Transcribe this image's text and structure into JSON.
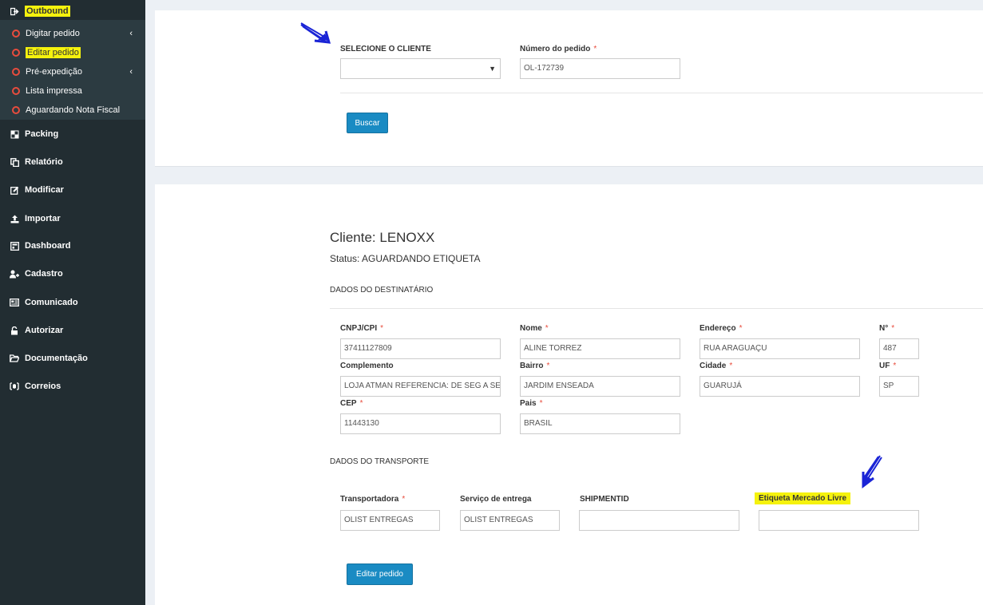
{
  "sidebar": {
    "outbound": {
      "label": "Outbound",
      "icon": "sign-out-icon"
    },
    "submenu": [
      {
        "label": "Digitar pedido",
        "has_chevron": true
      },
      {
        "label": "Editar pedido",
        "highlighted": true
      },
      {
        "label": "Pré-expedição",
        "has_chevron": true
      },
      {
        "label": "Lista impressa"
      },
      {
        "label": "Aguardando Nota Fiscal"
      }
    ],
    "items": [
      {
        "label": "Packing",
        "icon": "packing-icon"
      },
      {
        "label": "Relatório",
        "icon": "copy-icon"
      },
      {
        "label": "Modificar",
        "icon": "edit-icon"
      },
      {
        "label": "Importar",
        "icon": "upload-icon"
      },
      {
        "label": "Dashboard",
        "icon": "dashboard-icon"
      },
      {
        "label": "Cadastro",
        "icon": "user-add-icon"
      },
      {
        "label": "Comunicado",
        "icon": "newspaper-icon"
      },
      {
        "label": "Autorizar",
        "icon": "unlock-icon"
      },
      {
        "label": "Documentação",
        "icon": "folder-open-icon"
      },
      {
        "label": "Correios",
        "icon": "box-icon"
      }
    ]
  },
  "search": {
    "client_label": "SELECIONE O CLIENTE",
    "client_value": "",
    "order_label": "Número do pedido",
    "order_value": "OL-172739",
    "search_button": "Buscar"
  },
  "order": {
    "client_title": "Cliente: LENOXX",
    "status": "Status: AGUARDANDO ETIQUETA",
    "recipient_section": "DADOS DO DESTINATÁRIO",
    "transport_section": "DADOS DO TRANSPORTE",
    "required_mark": "*",
    "fields": {
      "cnpj": {
        "label": "CNPJ/CPI",
        "value": "37411127809"
      },
      "nome": {
        "label": "Nome",
        "value": "ALINE TORREZ"
      },
      "endereco": {
        "label": "Endereço",
        "value": "RUA ARAGUAÇU"
      },
      "numero": {
        "label": "N°",
        "value": "487"
      },
      "complemento": {
        "label": "Complemento",
        "value": "LOJA ATMAN REFERENCIA: DE SEG A SEX"
      },
      "bairro": {
        "label": "Bairro",
        "value": "JARDIM ENSEADA"
      },
      "cidade": {
        "label": "Cidade",
        "value": "GUARUJÁ"
      },
      "uf": {
        "label": "UF",
        "value": "SP"
      },
      "cep": {
        "label": "CEP",
        "value": "11443130"
      },
      "pais": {
        "label": "Pais",
        "value": "BRASIL"
      },
      "transportadora": {
        "label": "Transportadora",
        "value": "OLIST ENTREGAS"
      },
      "servico": {
        "label": "Serviço de entrega",
        "value": "OLIST ENTREGAS"
      },
      "shipmentid": {
        "label": "SHIPMENTID",
        "value": ""
      },
      "etiqueta": {
        "label": "Etiqueta Mercado Livre",
        "value": ""
      }
    },
    "edit_button": "Editar pedido"
  },
  "colors": {
    "sidebar_bg": "#222d32",
    "submenu_bg": "#2c3b41",
    "highlight": "#f5f20d",
    "button": "#1a8bc3",
    "required": "#e84c3d",
    "annotation_arrow": "#1a24d6"
  }
}
